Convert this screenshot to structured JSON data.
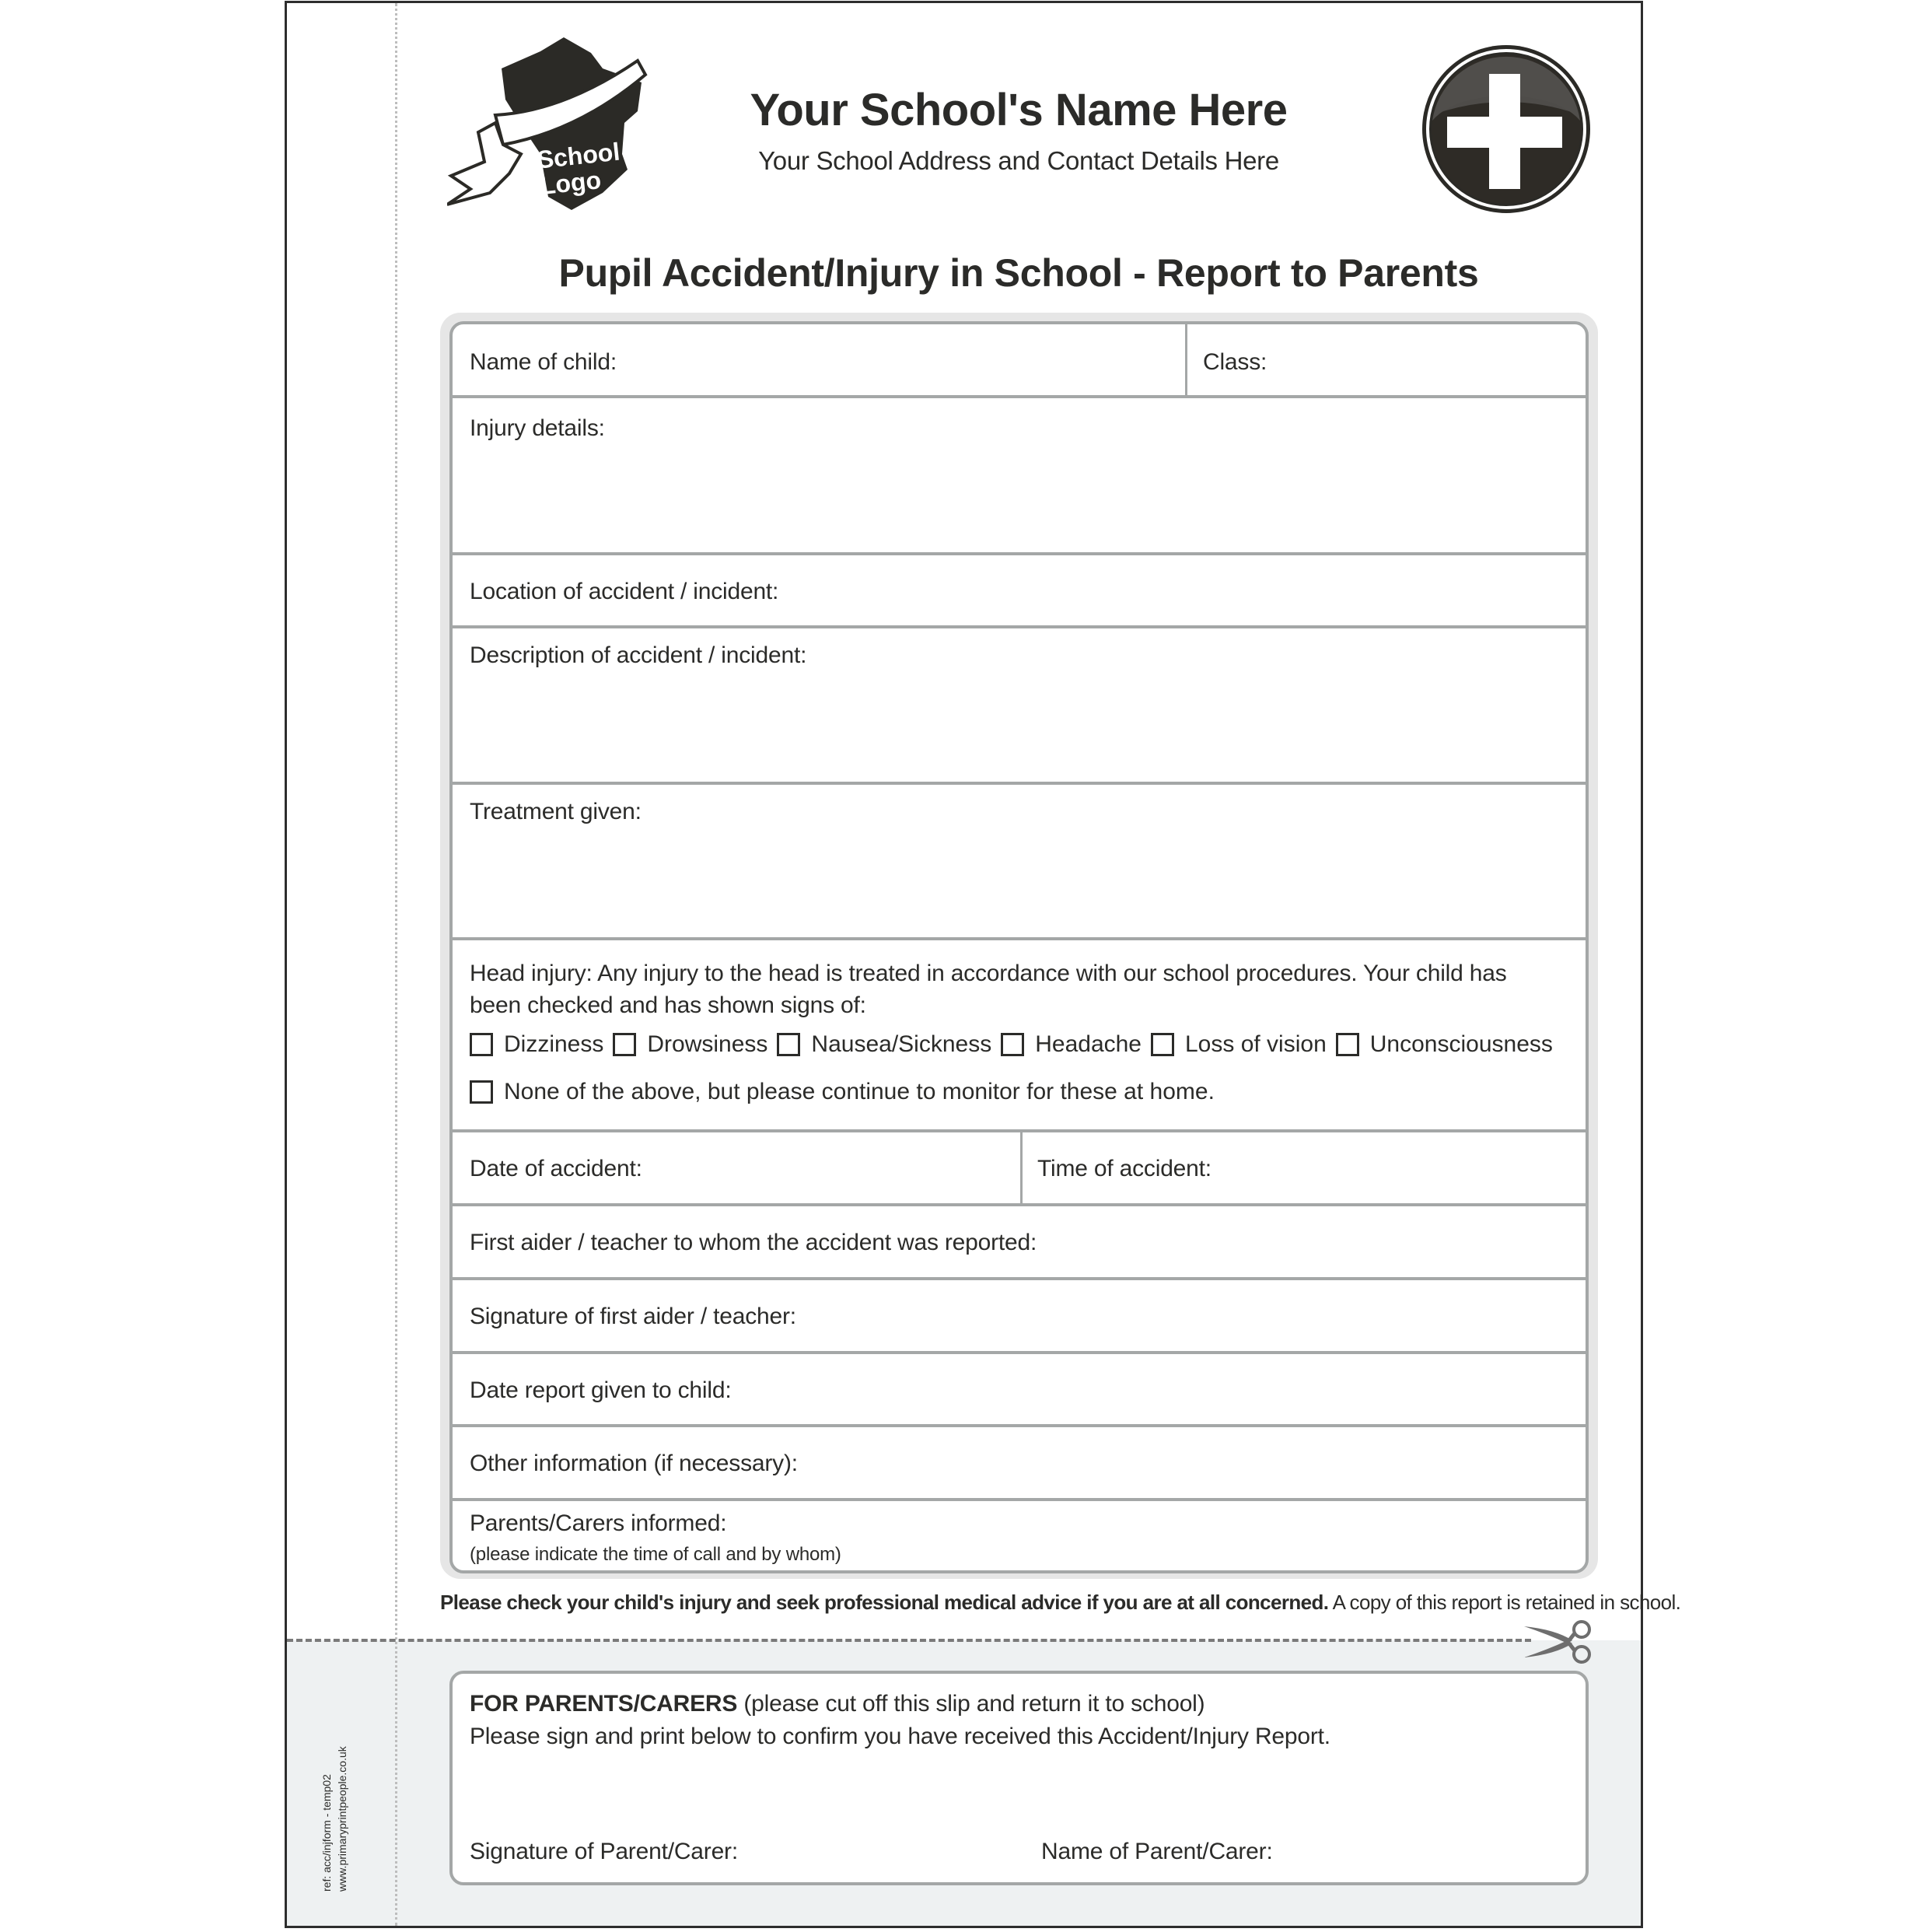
{
  "header": {
    "logo_text_line1": "School",
    "logo_text_line2": "Logo",
    "school_name": "Your School's Name Here",
    "school_address": "Your School Address and Contact Details Here",
    "badge_icon": "first-aid-cross"
  },
  "form": {
    "title": "Pupil Accident/Injury in School - Report to Parents",
    "fields": {
      "name_of_child": "Name of child:",
      "class": "Class:",
      "injury_details": "Injury details:",
      "location": "Location of accident / incident:",
      "description": "Description of accident / incident:",
      "treatment": "Treatment given:",
      "head_injury_text_line1": "Head injury: Any injury to the head is treated in accordance with our school procedures. Your child has",
      "head_injury_text_line2": "been checked and has shown signs of:",
      "date_of_accident": "Date of accident:",
      "time_of_accident": "Time of accident:",
      "first_aider": "First aider / teacher to whom the accident was reported:",
      "signature_first_aider": "Signature of first aider / teacher:",
      "date_report_given": "Date report given to child:",
      "other_information": "Other information (if necessary):",
      "parents_informed": "Parents/Carers informed:",
      "parents_informed_hint": "(please indicate the time of call and by whom)"
    },
    "symptoms": [
      {
        "label": "Dizziness",
        "checked": false
      },
      {
        "label": "Drowsiness",
        "checked": false
      },
      {
        "label": "Nausea/Sickness",
        "checked": false
      },
      {
        "label": "Headache",
        "checked": false
      },
      {
        "label": "Loss of vision",
        "checked": false
      },
      {
        "label": "Unconsciousness",
        "checked": false
      }
    ],
    "none_option": {
      "label": "None of the above, but please continue to monitor for these at home.",
      "checked": false
    }
  },
  "footer_note": {
    "bold": "Please check your child's injury and seek professional medical advice if you are at all concerned.",
    "regular": " A copy of this report is retained in school."
  },
  "slip": {
    "heading_bold": "FOR PARENTS/CARERS",
    "heading_regular": " (please cut off this slip and return it to school)",
    "instruction": "Please sign and print below to confirm you have received this Accident/Injury Report.",
    "signature_label": "Signature of Parent/Carer:",
    "name_label": "Name of Parent/Carer:"
  },
  "side_ref": {
    "ref": "ref: acc/injform - temp02",
    "website": "www.primaryprintpeople.co.uk"
  },
  "colors": {
    "text": "#2b2b29",
    "border": "#a4a7a7",
    "slip_background": "#eef1f2",
    "icon_dark": "#2b2a26"
  }
}
